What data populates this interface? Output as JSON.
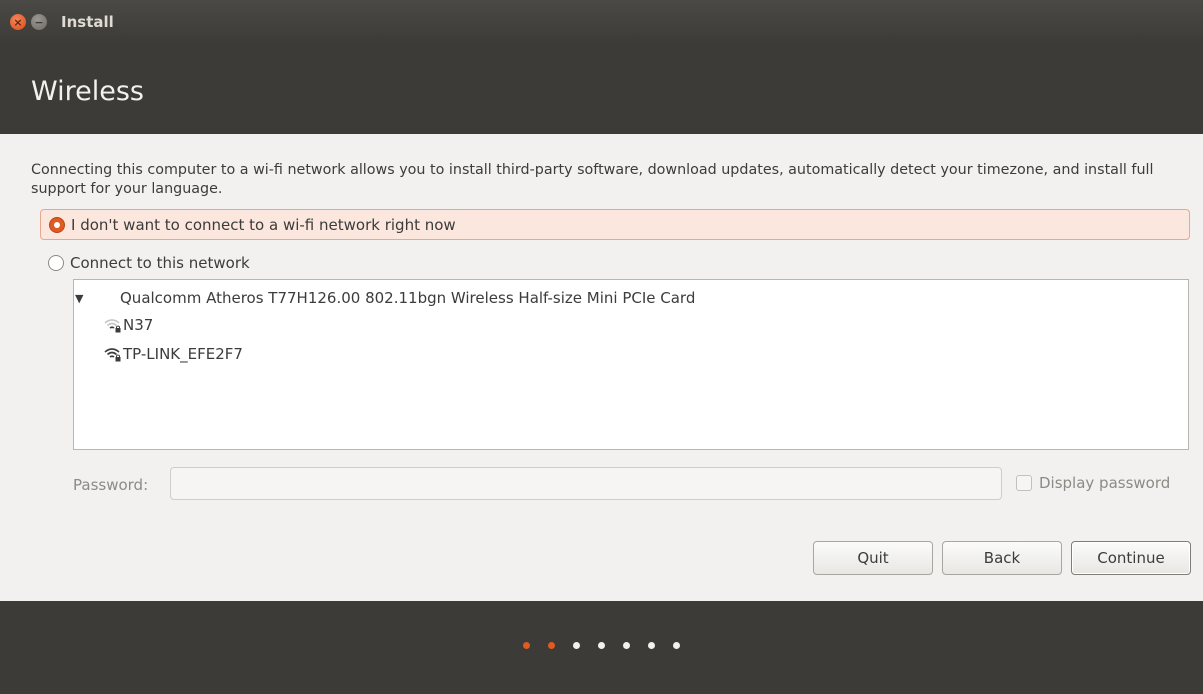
{
  "window": {
    "title": "Install",
    "close_icon": "close-icon",
    "minimize_icon": "minimize-icon"
  },
  "header": {
    "title": "Wireless"
  },
  "main": {
    "intro_text": "Connecting this computer to a wi-fi network allows you to install third-party software, download updates, automatically detect your timezone, and install full support for your language.",
    "options": [
      {
        "label": "I don't want to connect to a wi-fi network right now",
        "selected": true
      },
      {
        "label": "Connect to this network",
        "selected": false
      }
    ],
    "network_list": {
      "adapter": "Qualcomm Atheros T77H126.00 802.11bgn Wireless Half-size Mini PCIe Card",
      "expander_icon": "triangle-down-icon",
      "networks": [
        {
          "ssid": "N37",
          "icon": "wifi-weak-locked-icon",
          "signal": "weak"
        },
        {
          "ssid": "TP-LINK_EFE2F7",
          "icon": "wifi-strong-locked-icon",
          "signal": "strong"
        }
      ]
    },
    "password": {
      "label": "Password:",
      "value": "",
      "display_password_label": "Display password",
      "display_password_checked": false
    }
  },
  "buttons": {
    "quit": "Quit",
    "back": "Back",
    "continue": "Continue"
  },
  "progress": {
    "total_steps": 7,
    "current_step": 2
  },
  "colors": {
    "accent": "#e05a22",
    "chrome": "#3c3b37",
    "content_bg": "#f2f1f0"
  }
}
